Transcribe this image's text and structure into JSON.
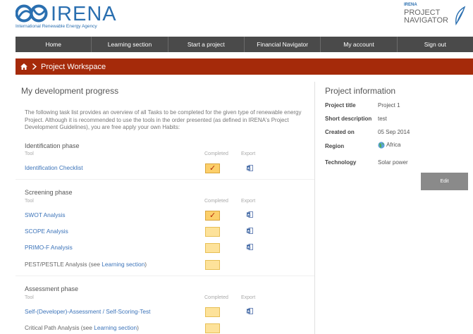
{
  "header": {
    "logo_text": "IRENA",
    "logo_subtitle": "International Renewable Energy Agency",
    "pn_small": "IRENA",
    "pn_line1": "PROJECT",
    "pn_line2": "NAVIGATOR"
  },
  "nav": {
    "items": [
      "Home",
      "Learning section",
      "Start a project",
      "Financial Navigator",
      "My account",
      "Sign out"
    ]
  },
  "banner": {
    "title": "Project Workspace"
  },
  "main": {
    "title": "My development progress",
    "intro": "The following task list provides an overview of all Tasks to be completed for the given type of renewable energy Project. Although it is recommended to use the tools in the order presented (as defined in IRENA's Project Development Guidelines), you are free apply your own Habits:",
    "col_tool": "Tool",
    "col_completed": "Completed",
    "col_export": "Export",
    "phases": [
      {
        "name": "Identification phase",
        "tools": [
          {
            "label": "Identification Checklist",
            "completed": true,
            "export": true
          }
        ]
      },
      {
        "name": "Screening phase",
        "tools": [
          {
            "label": "SWOT Analysis",
            "completed": true,
            "export": true
          },
          {
            "label": "SCOPE Analysis",
            "completed": false,
            "export": true
          },
          {
            "label": "PRIMO-F Analysis",
            "completed": false,
            "export": true
          },
          {
            "label": "PEST/PESTLE Analysis (see ",
            "link": "Learning section",
            "suffix": ")",
            "completed": false,
            "export": false
          }
        ]
      },
      {
        "name": "Assessment phase",
        "tools": [
          {
            "label": "Self-(Developer)-Assessment / Self-Scoring-Test",
            "completed": false,
            "export": true
          },
          {
            "label": "Critical Path Analysis (see ",
            "link": "Learning section",
            "suffix": ")",
            "completed": false,
            "export": false
          }
        ]
      }
    ]
  },
  "info": {
    "title": "Project information",
    "rows": [
      {
        "label": "Project title",
        "value": "Project 1"
      },
      {
        "label": "Short description",
        "value": "test"
      },
      {
        "label": "Created on",
        "value": "05 Sep 2014"
      },
      {
        "label": "Region",
        "value": "Africa"
      },
      {
        "label": "Technology",
        "value": "Solar power"
      }
    ],
    "edit_label": "Edit"
  },
  "colors": {
    "brand_blue": "#2a6fb0",
    "nav_bg": "#4a4a4a",
    "banner_bg": "#a52a0a",
    "link": "#3b73b9",
    "checkbox_fill": "#fde29a",
    "check_mark": "#b22a0a"
  },
  "icons": [
    "irena-logo-icon",
    "home-icon",
    "chevron-right-icon",
    "checkmark-icon",
    "word-document-icon",
    "globe-icon"
  ]
}
